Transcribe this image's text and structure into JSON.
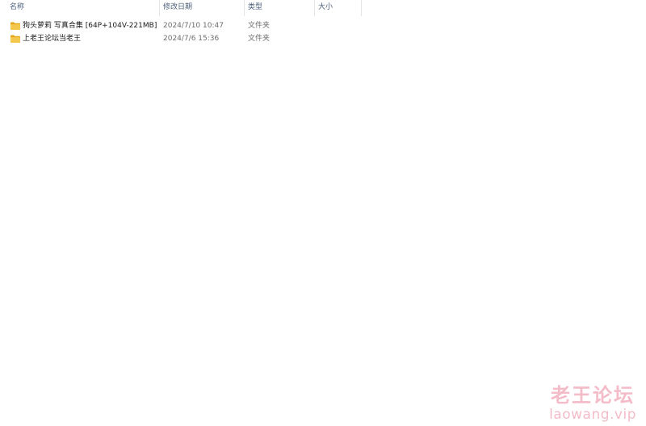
{
  "columns": {
    "name": "名称",
    "date": "修改日期",
    "type": "类型",
    "size": "大小"
  },
  "sort_indicator": "^",
  "rows": [
    {
      "name": "狗头萝莉 写真合集 [64P+104V-221MB]",
      "date": "2024/7/10 10:47",
      "type": "文件夹",
      "icon": "folder-icon"
    },
    {
      "name": "上老王论坛当老王",
      "date": "2024/7/6 15:36",
      "type": "文件夹",
      "icon": "folder-icon"
    }
  ],
  "watermark": {
    "title": "老王论坛",
    "url": "laowang.vip"
  },
  "colors": {
    "header_text": "#4c607a",
    "folder": "#f4c84c",
    "folder_tab": "#e3a821",
    "watermark": "#f3bcc8",
    "row_hover": "#e5f3ff"
  }
}
